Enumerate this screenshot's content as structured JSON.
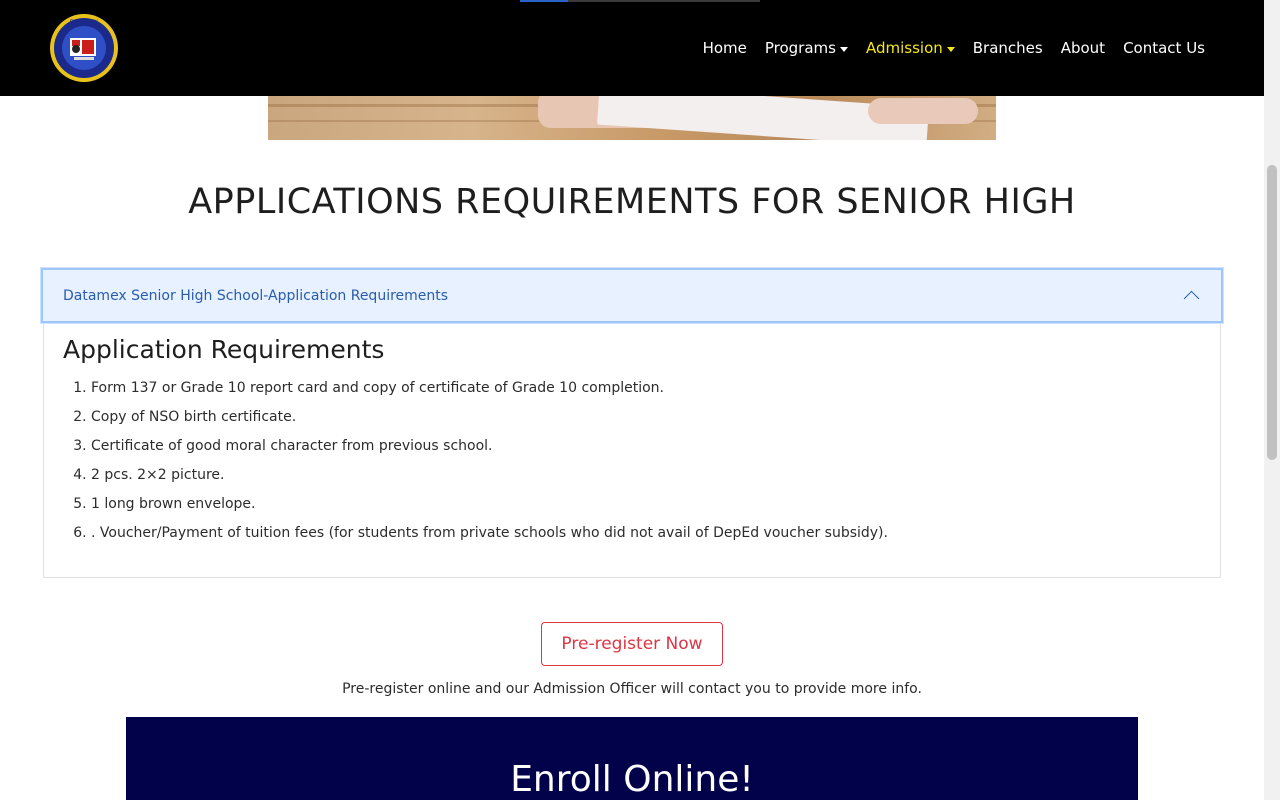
{
  "nav": {
    "logo_alt": "DATAMEX INSTITUTE OF COMPUTER TECHNOLOGY",
    "items": [
      {
        "label": "Home",
        "dropdown": false,
        "active": false
      },
      {
        "label": "Programs",
        "dropdown": true,
        "active": false
      },
      {
        "label": "Admission",
        "dropdown": true,
        "active": true
      },
      {
        "label": "Branches",
        "dropdown": false,
        "active": false
      },
      {
        "label": "About",
        "dropdown": false,
        "active": false
      },
      {
        "label": "Contact Us",
        "dropdown": false,
        "active": false
      }
    ],
    "active_color": "#f5e71a"
  },
  "page": {
    "title": "APPLICATIONS REQUIREMENTS FOR SENIOR HIGH"
  },
  "accordion": {
    "header": "Datamex Senior High School-Application Requirements",
    "expanded": true,
    "body_title": "Application Requirements",
    "items": [
      "Form 137 or Grade 10 report card and copy of certificate of Grade 10 completion.",
      "Copy of NSO birth certificate.",
      "Certificate of good moral character from previous school.",
      "2 pcs. 2×2 picture.",
      "1 long brown envelope.",
      ". Voucher/Payment of tuition fees (for students from private schools who did not avail of DepEd voucher subsidy)."
    ]
  },
  "preregister": {
    "button": "Pre-register Now",
    "note": "Pre-register online and our Admission Officer will contact you to provide more info."
  },
  "enroll": {
    "title": "Enroll Online!"
  },
  "colors": {
    "nav_bg": "#000000",
    "accordion_header_bg": "#e7f1ff",
    "accordion_text": "#2a5cad",
    "prereg_red": "#dc3545",
    "enroll_bg": "#02024a"
  }
}
